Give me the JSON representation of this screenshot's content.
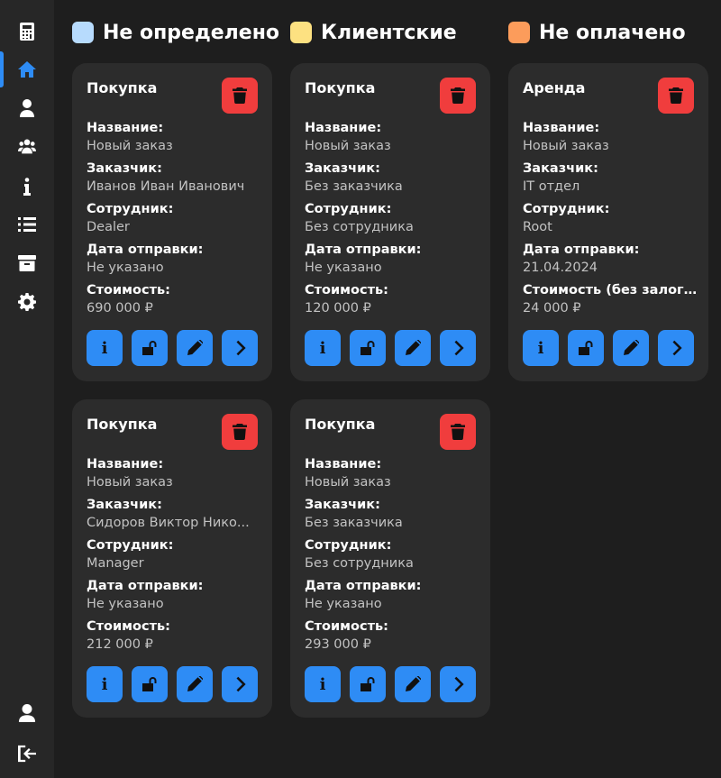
{
  "sidebar": {
    "items": [
      {
        "name": "calculator-icon"
      },
      {
        "name": "home-icon"
      },
      {
        "name": "user-tie-icon"
      },
      {
        "name": "users-icon"
      },
      {
        "name": "info-icon"
      },
      {
        "name": "list-icon"
      },
      {
        "name": "archive-icon"
      },
      {
        "name": "gear-icon"
      }
    ],
    "active": "home-icon",
    "bottom": [
      {
        "name": "profile-icon"
      },
      {
        "name": "logout-icon"
      }
    ]
  },
  "legend": [
    {
      "label": "Не определено",
      "color": "#b7dbfd"
    },
    {
      "label": "Клиентские",
      "color": "#fde181"
    },
    {
      "label": "Не оплачено",
      "color": "#fc9c5b"
    }
  ],
  "colors": {
    "accent": "#2e8cf5",
    "danger": "#f03d3d",
    "card": "#2c2c2c",
    "background": "#1e1e1e"
  },
  "field_labels": {
    "name": "Название:",
    "customer": "Заказчик:",
    "employee": "Сотрудник:",
    "ship_date": "Дата отправки:"
  },
  "cards": [
    {
      "title": "Покупка",
      "name": "Новый заказ",
      "customer": "Иванов Иван Иванович",
      "employee": "Dealer",
      "ship_date": "Не указано",
      "cost_label": "Стоимость:",
      "cost": "690 000 ₽"
    },
    {
      "title": "Покупка",
      "name": "Новый заказ",
      "customer": "Без заказчика",
      "employee": "Без сотрудника",
      "ship_date": "Не указано",
      "cost_label": "Стоимость:",
      "cost": "120 000 ₽"
    },
    {
      "title": "Аренда",
      "name": "Новый заказ",
      "customer": "IT отдел",
      "employee": "Root",
      "ship_date": "21.04.2024",
      "cost_label": "Стоимость (без залог...",
      "cost": "24 000 ₽"
    },
    {
      "title": "Покупка",
      "name": "Новый заказ",
      "customer": "Сидоров Виктор Нико...",
      "employee": "Manager",
      "ship_date": "Не указано",
      "cost_label": "Стоимость:",
      "cost": "212 000 ₽"
    },
    {
      "title": "Покупка",
      "name": "Новый заказ",
      "customer": "Без заказчика",
      "employee": "Без сотрудника",
      "ship_date": "Не указано",
      "cost_label": "Стоимость:",
      "cost": "293 000 ₽"
    }
  ]
}
